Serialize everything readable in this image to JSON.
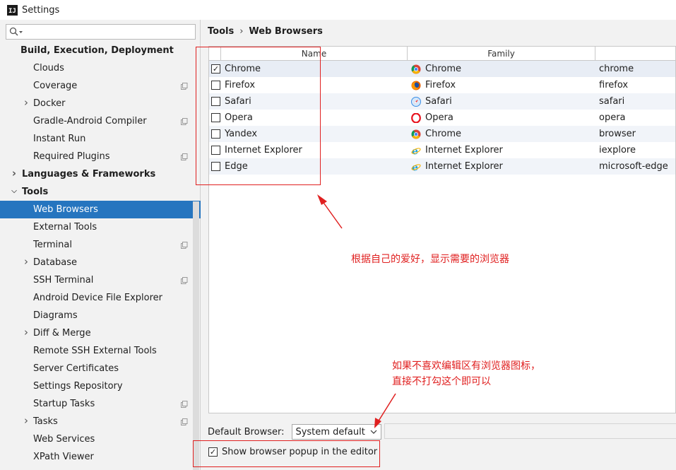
{
  "window": {
    "title": "Settings"
  },
  "search": {
    "placeholder": ""
  },
  "sidebar": {
    "items": [
      {
        "kind": "section",
        "label": "Build, Execution, Deployment"
      },
      {
        "kind": "child",
        "label": "Clouds"
      },
      {
        "kind": "child",
        "label": "Coverage",
        "copy": true
      },
      {
        "kind": "child",
        "label": "Docker",
        "expandable": true
      },
      {
        "kind": "child",
        "label": "Gradle-Android Compiler",
        "copy": true
      },
      {
        "kind": "child",
        "label": "Instant Run"
      },
      {
        "kind": "child",
        "label": "Required Plugins",
        "copy": true
      },
      {
        "kind": "group",
        "label": "Languages & Frameworks",
        "expandable": true
      },
      {
        "kind": "group",
        "label": "Tools",
        "expanded": true
      },
      {
        "kind": "child",
        "label": "Web Browsers",
        "selected": true
      },
      {
        "kind": "child",
        "label": "External Tools"
      },
      {
        "kind": "child",
        "label": "Terminal",
        "copy": true
      },
      {
        "kind": "child",
        "label": "Database",
        "expandable": true
      },
      {
        "kind": "child",
        "label": "SSH Terminal",
        "copy": true
      },
      {
        "kind": "child",
        "label": "Android Device File Explorer"
      },
      {
        "kind": "child",
        "label": "Diagrams"
      },
      {
        "kind": "child",
        "label": "Diff & Merge",
        "expandable": true
      },
      {
        "kind": "child",
        "label": "Remote SSH External Tools"
      },
      {
        "kind": "child",
        "label": "Server Certificates"
      },
      {
        "kind": "child",
        "label": "Settings Repository"
      },
      {
        "kind": "child",
        "label": "Startup Tasks",
        "copy": true
      },
      {
        "kind": "child",
        "label": "Tasks",
        "expandable": true,
        "copy": true
      },
      {
        "kind": "child",
        "label": "Web Services"
      },
      {
        "kind": "child",
        "label": "XPath Viewer"
      }
    ]
  },
  "breadcrumb": {
    "parent": "Tools",
    "separator": "›",
    "current": "Web Browsers"
  },
  "table": {
    "columns": {
      "name": "Name",
      "family": "Family",
      "path": ""
    },
    "rows": [
      {
        "checked": true,
        "name": "Chrome",
        "family": "Chrome",
        "family_icon": "chrome-icon",
        "path": "chrome"
      },
      {
        "checked": false,
        "name": "Firefox",
        "family": "Firefox",
        "family_icon": "firefox-icon",
        "path": "firefox"
      },
      {
        "checked": false,
        "name": "Safari",
        "family": "Safari",
        "family_icon": "safari-icon",
        "path": "safari"
      },
      {
        "checked": false,
        "name": "Opera",
        "family": "Opera",
        "family_icon": "opera-icon",
        "path": "opera"
      },
      {
        "checked": false,
        "name": "Yandex",
        "family": "Chrome",
        "family_icon": "chrome-icon",
        "path": "browser"
      },
      {
        "checked": false,
        "name": "Internet Explorer",
        "family": "Internet Explorer",
        "family_icon": "ie-icon",
        "path": "iexplore"
      },
      {
        "checked": false,
        "name": "Edge",
        "family": "Internet Explorer",
        "family_icon": "ie-icon",
        "path": "microsoft-edge"
      }
    ]
  },
  "default_browser": {
    "label": "Default Browser:",
    "value": "System default"
  },
  "popup_option": {
    "label": "Show browser popup in the editor",
    "checked": true
  },
  "annotations": {
    "note1": "根据自己的爱好，显示需要的浏览器",
    "note2_line1": "如果不喜欢编辑区有浏览器图标，",
    "note2_line2": "直接不打勾这个即可以"
  },
  "colors": {
    "selection": "#2675bf",
    "annotation": "#e02020"
  }
}
